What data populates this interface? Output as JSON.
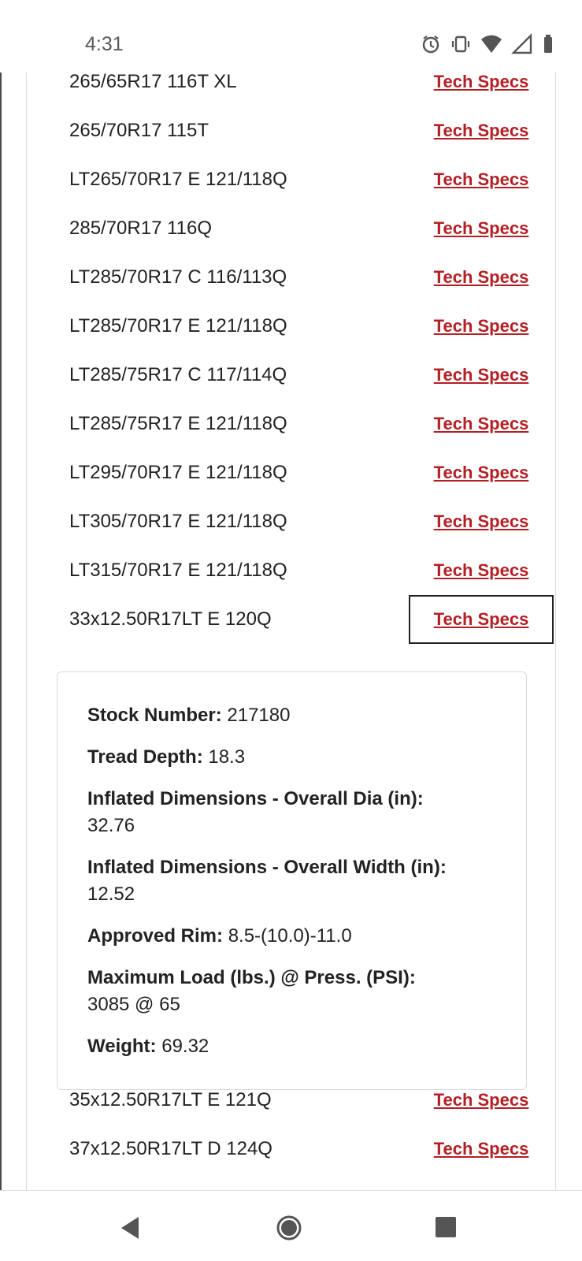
{
  "status": {
    "time": "4:31",
    "icons": [
      "alarm-icon",
      "vibrate-icon",
      "wifi-icon",
      "signal-icon",
      "battery-icon"
    ]
  },
  "tire_sizes": [
    {
      "size": "265/65R17 116T XL",
      "link": "Tech Specs"
    },
    {
      "size": "265/70R17 115T",
      "link": "Tech Specs"
    },
    {
      "size": "LT265/70R17 E 121/118Q",
      "link": "Tech Specs"
    },
    {
      "size": "285/70R17 116Q",
      "link": "Tech Specs"
    },
    {
      "size": "LT285/70R17 C 116/113Q",
      "link": "Tech Specs"
    },
    {
      "size": "LT285/70R17 E 121/118Q",
      "link": "Tech Specs"
    },
    {
      "size": "LT285/75R17 C 117/114Q",
      "link": "Tech Specs"
    },
    {
      "size": "LT285/75R17 E 121/118Q",
      "link": "Tech Specs"
    },
    {
      "size": "LT295/70R17 E 121/118Q",
      "link": "Tech Specs"
    },
    {
      "size": "LT305/70R17 E 121/118Q",
      "link": "Tech Specs"
    },
    {
      "size": "LT315/70R17 E 121/118Q",
      "link": "Tech Specs"
    },
    {
      "size": "33x12.50R17LT E 120Q",
      "link": "Tech Specs"
    },
    {
      "size": "35x12.50R17LT E 121Q",
      "link": "Tech Specs"
    },
    {
      "size": "37x12.50R17LT D 124Q",
      "link": "Tech Specs"
    }
  ],
  "details": [
    {
      "label": "Stock Number:",
      "value": "217180"
    },
    {
      "label": "Tread Depth:",
      "value": "18.3"
    },
    {
      "label": "Inflated Dimensions - Overall Dia (in):",
      "value": "32.76"
    },
    {
      "label": "Inflated Dimensions - Overall Width (in):",
      "value": "12.52"
    },
    {
      "label": "Approved Rim:",
      "value": "8.5-(10.0)-11.0"
    },
    {
      "label": "Maximum Load (lbs.) @ Press. (PSI):",
      "value": "3085 @ 65"
    },
    {
      "label": "Weight:",
      "value": "69.32"
    }
  ],
  "colors": {
    "link": "#b41f24",
    "text": "#222222",
    "border": "#d9d9d9"
  },
  "navigation": [
    "back-icon",
    "home-icon",
    "recents-icon"
  ]
}
